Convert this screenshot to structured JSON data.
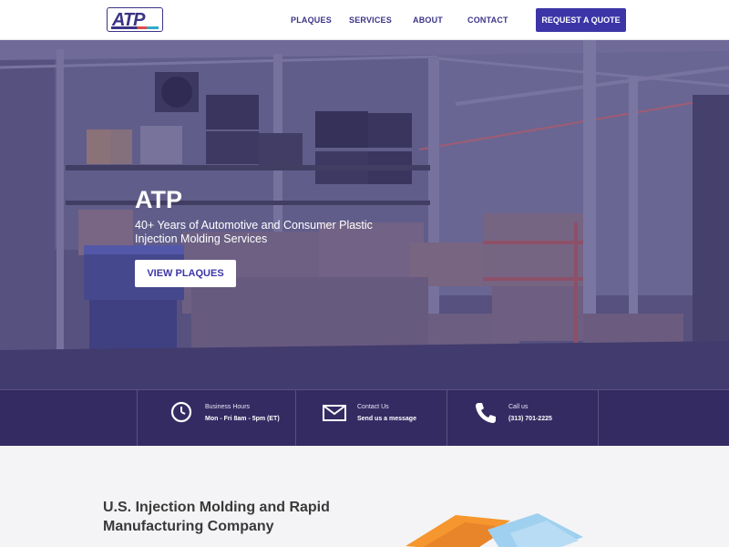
{
  "header": {
    "logo_text": "ATP",
    "nav": {
      "plaques": "PLAQUES",
      "services": "SERVICES",
      "about": "ABOUT",
      "contact": "CONTACT"
    },
    "cta_label": "REQUEST A QUOTE"
  },
  "hero": {
    "title": "ATP",
    "subtitle": "40+ Years of Automotive and Consumer Plastic Injection Molding Services",
    "button_label": "VIEW PLAQUES"
  },
  "info_bar": {
    "hours": {
      "label": "Business Hours",
      "value": "Mon - Fri 8am - 5pm (ET)",
      "icon": "clock-icon"
    },
    "contact": {
      "label": "Contact Us",
      "value": "Send us a message",
      "icon": "envelope-icon"
    },
    "call": {
      "label": "Call us",
      "value": "(313) 701-2225",
      "icon": "phone-icon"
    }
  },
  "section": {
    "heading": "U.S. Injection Molding and Rapid Manufacturing Company"
  },
  "colors": {
    "brand": "#3b35a8",
    "overlay": "#302660",
    "logo_red": "#e14b4b",
    "logo_blue": "#33a9c9",
    "orange": "#f5962e",
    "light_blue": "#9fd0ef"
  }
}
